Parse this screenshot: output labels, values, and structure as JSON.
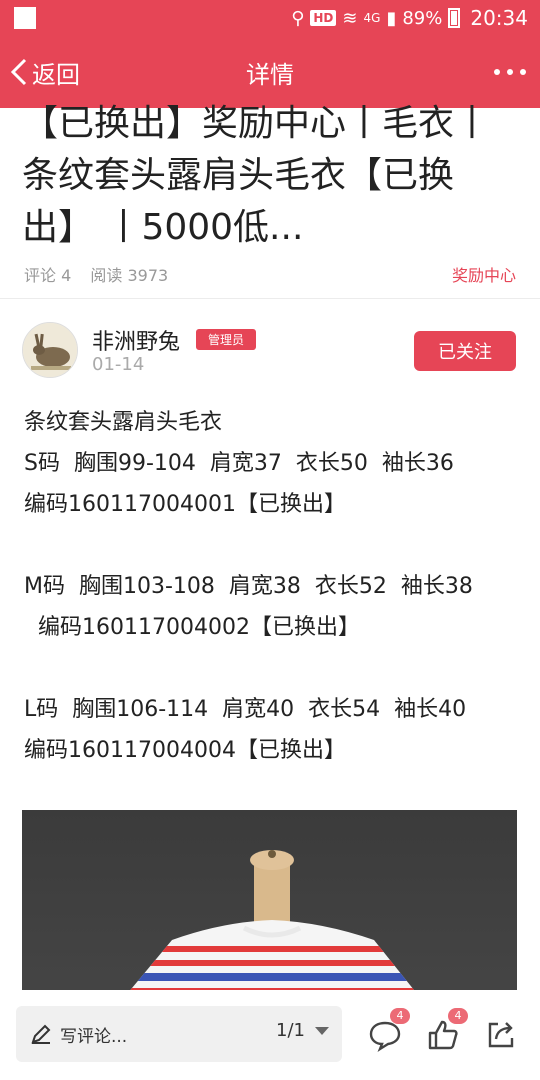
{
  "status_bar": {
    "hd_label": "HD",
    "network": "4G",
    "battery": "89%",
    "time": "20:34"
  },
  "header": {
    "back_label": "返回",
    "title": "详情"
  },
  "post": {
    "title_lines": [
      "【已换出】奖励中心丨毛衣丨",
      "条纹套头露肩头毛衣【已换",
      "出】 丨5000低..."
    ],
    "comments_label": "评论 4",
    "reads_label": "阅读 3973",
    "category": "奖励中心"
  },
  "author": {
    "name": "非洲野兔",
    "role_badge": "管理员",
    "date": "01-14",
    "follow_label": "已关注"
  },
  "content": {
    "lines": [
      "条纹套头露肩头毛衣",
      "S码  胸围99-104  肩宽37  衣长50  袖长36",
      "编码160117004001【已换出】",
      "",
      "M码  胸围103-108  肩宽38  衣长52  袖长38",
      "  编码160117004002【已换出】",
      "",
      "L码  胸围106-114  肩宽40  衣长54  袖长40",
      "编码160117004004【已换出】"
    ]
  },
  "bottom_bar": {
    "comment_placeholder": "写评论...",
    "pager": "1/1",
    "comment_count": "4",
    "like_count": "4"
  },
  "colors": {
    "brand": "#e64556"
  }
}
